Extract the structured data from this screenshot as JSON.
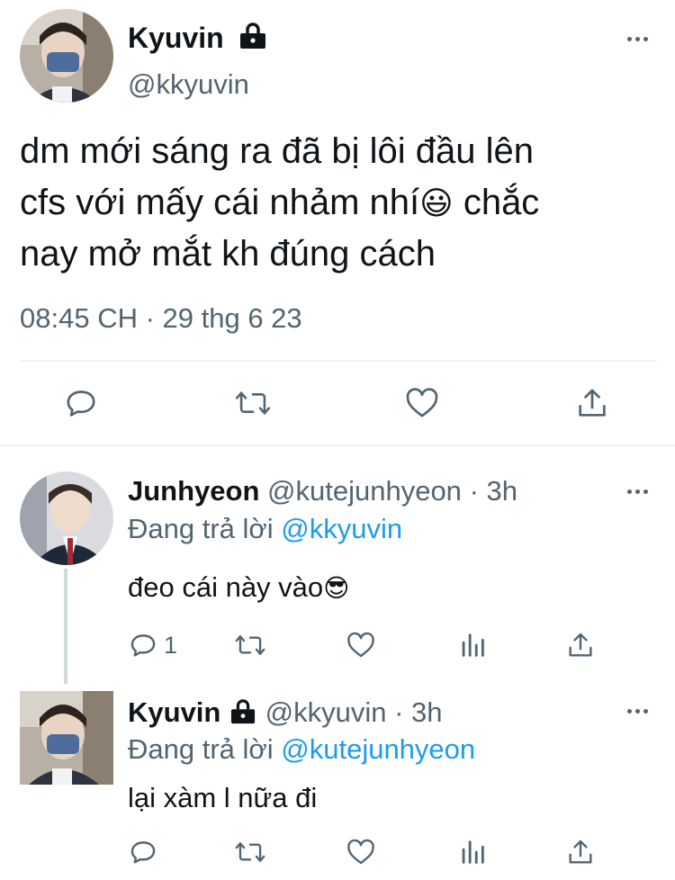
{
  "main_tweet": {
    "author_name": "Kyuvin",
    "author_handle": "@kkyuvin",
    "text_line1": "dm mới sáng ra đã bị lôi đầu lên",
    "text_line2a": "cfs với mấy cái nhảm nhí",
    "text_line2b": " chắc",
    "text_line3": "nay mở mắt kh đúng cách",
    "emoji": "😃",
    "timestamp": "08:45 CH · 29 thg 6 23"
  },
  "reply1": {
    "author_name": "Junhyeon",
    "author_handle": "@kutejunhyeon",
    "time": "· 3h",
    "replying_prefix": "Đang trả lời",
    "replying_to": "@kkyuvin",
    "text": "đeo cái này vào",
    "emoji": "😎",
    "reply_count": "1"
  },
  "reply2": {
    "author_name": "Kyuvin",
    "author_handle": "@kkyuvin",
    "time": "· 3h",
    "replying_prefix": "Đang trả lời",
    "replying_to": "@kutejunhyeon",
    "text": "lại xàm l nữa đi"
  },
  "colors": {
    "text": "#0f1419",
    "muted": "#536471",
    "link": "#1d9bf0",
    "divider": "#eff3f4"
  }
}
